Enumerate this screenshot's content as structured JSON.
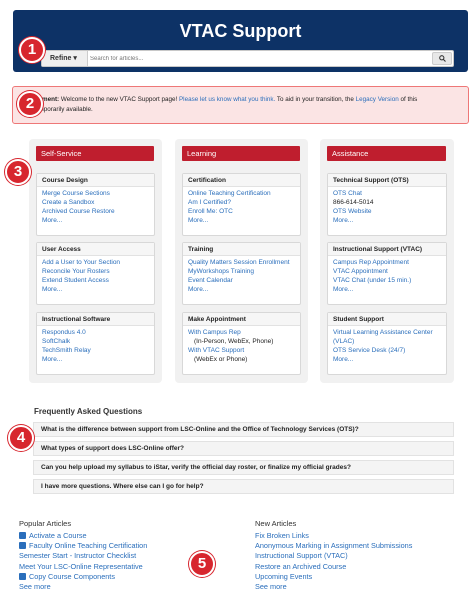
{
  "header": {
    "title": "VTAC Support",
    "refine_label": "Refine ▾",
    "search_placeholder": "Search for articles...",
    "search_icon": "magnifier-icon"
  },
  "badges": [
    "1",
    "2",
    "3",
    "4",
    "5"
  ],
  "announcement": {
    "lead": "cement:",
    "text1": " Welcome to the new VTAC Support page! ",
    "link1": "Please let us know what you think.",
    "text2": "  To aid in your transition, the ",
    "link2": "Legacy Version",
    "text3": " of this",
    "line2": "emporarily available."
  },
  "columns": [
    {
      "header": "Self-Service",
      "cards": [
        {
          "title": "Course Design",
          "items": [
            "Merge Course Sections",
            "Create a Sandbox",
            "Archived Course Restore",
            "More..."
          ]
        },
        {
          "title": "User Access",
          "items": [
            "Add a User to Your Section",
            "Reconcile Your Rosters",
            "Extend Student Access",
            "More..."
          ]
        },
        {
          "title": "Instructional Software",
          "items": [
            "Respondus 4.0",
            "SoftChalk",
            "TechSmith Relay",
            "More..."
          ]
        }
      ]
    },
    {
      "header": "Learning",
      "cards": [
        {
          "title": "Certification",
          "items": [
            "Online Teaching Certification",
            "Am I Certified?",
            "Enroll Me: OTC",
            "More..."
          ]
        },
        {
          "title": "Training",
          "items": [
            "Quality Matters Session Enrollment",
            "MyWorkshops Training",
            "Event Calendar",
            "More..."
          ]
        },
        {
          "title": "Make Appointment",
          "items": [
            "With Campus Rep",
            "(In-Person, WebEx, Phone)",
            "With VTAC Support",
            "(WebEx or Phone)"
          ]
        }
      ]
    },
    {
      "header": "Assistance",
      "cards": [
        {
          "title": "Technical Support (OTS)",
          "items": [
            "OTS Chat",
            "866-614-5014",
            "OTS Website",
            "More..."
          ]
        },
        {
          "title": "Instructional Support (VTAC)",
          "items": [
            "Campus Rep Appointment",
            "VTAC Appointment",
            "VTAC Chat (under 15 min.)",
            "More..."
          ]
        },
        {
          "title": "Student Support",
          "items": [
            "Virtual Learning Assistance Center",
            "(VLAC)",
            "OTS Service Desk (24/7)",
            "More..."
          ]
        }
      ]
    }
  ],
  "faq": {
    "title": "Frequently Asked Questions",
    "items": [
      "What is the difference between support from LSC-Online and the Office of Technology Services (OTS)?",
      "What types of support does LSC-Online offer?",
      "Can you help upload my syllabus to iStar, verify the official day roster, or finalize my official grades?",
      "I have more questions. Where else can I go for help?"
    ]
  },
  "popular": {
    "title": "Popular Articles",
    "items": [
      "Activate a Course",
      "Faculty Online Teaching Certification",
      "Semester Start - Instructor Checklist",
      "Meet Your LSC-Online Representative",
      "Copy Course Components",
      "See more"
    ]
  },
  "new_articles": {
    "title": "New Articles",
    "items": [
      "Fix Broken Links",
      "Anonymous Marking in Assignment Submissions",
      "Instructional Support (VTAC)",
      "Restore an Archived Course",
      "Upcoming Events",
      "See more"
    ]
  },
  "colors": {
    "header": "#0d3266",
    "accent": "#bf1e2e",
    "badge": "#d7262e",
    "link": "#2a6ebb"
  }
}
